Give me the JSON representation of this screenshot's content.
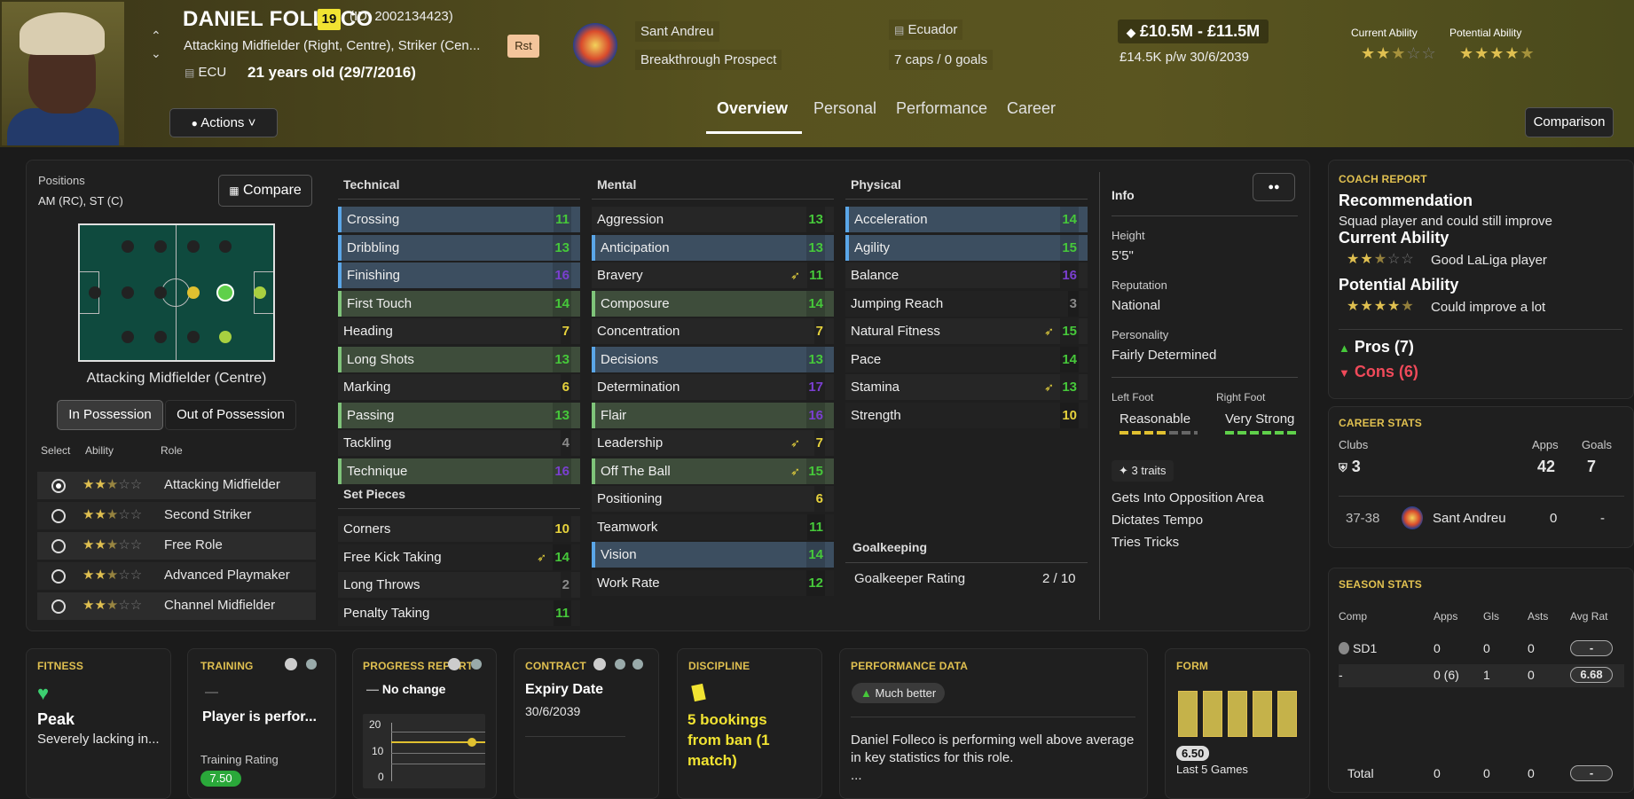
{
  "player": {
    "name": "DANIEL FOLLECO",
    "number": "19",
    "id": "(ID: 2002134423)",
    "position": "Attacking Midfielder (Right, Centre), Striker (Cen...",
    "nationality_code": "ECU",
    "age": "21 years old (29/7/2016)",
    "role_badge": "Rst"
  },
  "club": {
    "name": "Sant Andreu",
    "status": "Breakthrough Prospect"
  },
  "nation": {
    "name": "Ecuador",
    "caps": "7 caps / 0 goals"
  },
  "value": {
    "range": "£10.5M - £11.5M",
    "wage": "£14.5K p/w 30/6/2039"
  },
  "ability": {
    "current_label": "Current Ability",
    "potential_label": "Potential Ability",
    "current_stars": 2.5,
    "potential_stars": 4.5
  },
  "actions_label": "Actions",
  "tabs": [
    "Overview",
    "Personal",
    "Performance",
    "Career"
  ],
  "comparison_label": "Comparison",
  "positions": {
    "label": "Positions",
    "value": "AM (RC), ST (C)",
    "compare": "Compare",
    "role_name": "Attacking Midfielder (Centre)",
    "in_possession": "In Possession",
    "out_possession": "Out of Possession",
    "cols": [
      "Select",
      "Ability",
      "Role"
    ],
    "roles": [
      {
        "name": "Attacking Midfielder",
        "stars": 2.5,
        "selected": true
      },
      {
        "name": "Second Striker",
        "stars": 2.5,
        "selected": false
      },
      {
        "name": "Free Role",
        "stars": 2.5,
        "selected": false
      },
      {
        "name": "Advanced Playmaker",
        "stars": 2.5,
        "selected": false
      },
      {
        "name": "Channel Midfielder",
        "stars": 2.5,
        "selected": false
      }
    ]
  },
  "technical": {
    "title": "Technical",
    "items": [
      [
        "Crossing",
        "11",
        "g",
        "b"
      ],
      [
        "Dribbling",
        "13",
        "g",
        "b"
      ],
      [
        "Finishing",
        "16",
        "p",
        "b"
      ],
      [
        "First Touch",
        "14",
        "g",
        "g"
      ],
      [
        "Heading",
        "7",
        "y",
        ""
      ],
      [
        "Long Shots",
        "13",
        "g",
        "g"
      ],
      [
        "Marking",
        "6",
        "y",
        ""
      ],
      [
        "Passing",
        "13",
        "g",
        "g"
      ],
      [
        "Tackling",
        "4",
        "gr",
        ""
      ],
      [
        "Technique",
        "16",
        "p",
        "g"
      ]
    ]
  },
  "set_pieces": {
    "title": "Set Pieces",
    "items": [
      [
        "Corners",
        "10",
        "y",
        ""
      ],
      [
        "Free Kick Taking",
        "14",
        "g",
        ""
      ],
      [
        "Long Throws",
        "2",
        "gr",
        ""
      ],
      [
        "Penalty Taking",
        "11",
        "g",
        ""
      ]
    ]
  },
  "mental": {
    "title": "Mental",
    "items": [
      [
        "Aggression",
        "13",
        "g",
        ""
      ],
      [
        "Anticipation",
        "13",
        "g",
        "b"
      ],
      [
        "Bravery",
        "11",
        "g",
        ""
      ],
      [
        "Composure",
        "14",
        "g",
        "g"
      ],
      [
        "Concentration",
        "7",
        "y",
        ""
      ],
      [
        "Decisions",
        "13",
        "g",
        "b"
      ],
      [
        "Determination",
        "17",
        "p",
        ""
      ],
      [
        "Flair",
        "16",
        "p",
        "g"
      ],
      [
        "Leadership",
        "7",
        "y",
        ""
      ],
      [
        "Off The Ball",
        "15",
        "g",
        "g"
      ],
      [
        "Positioning",
        "6",
        "y",
        ""
      ],
      [
        "Teamwork",
        "11",
        "g",
        ""
      ],
      [
        "Vision",
        "14",
        "g",
        "b"
      ],
      [
        "Work Rate",
        "12",
        "g",
        ""
      ]
    ]
  },
  "physical": {
    "title": "Physical",
    "items": [
      [
        "Acceleration",
        "14",
        "g",
        "b"
      ],
      [
        "Agility",
        "15",
        "g",
        "b"
      ],
      [
        "Balance",
        "16",
        "p",
        ""
      ],
      [
        "Jumping Reach",
        "3",
        "gr",
        ""
      ],
      [
        "Natural Fitness",
        "15",
        "g",
        ""
      ],
      [
        "Pace",
        "14",
        "g",
        ""
      ],
      [
        "Stamina",
        "13",
        "g",
        ""
      ],
      [
        "Strength",
        "10",
        "y",
        ""
      ]
    ]
  },
  "goalkeeping": {
    "title": "Goalkeeping",
    "label": "Goalkeeper Rating",
    "value": "2 / 10"
  },
  "info": {
    "title": "Info",
    "height_label": "Height",
    "height": "5'5\"",
    "rep_label": "Reputation",
    "rep": "National",
    "pers_label": "Personality",
    "pers": "Fairly Determined",
    "lf_label": "Left Foot",
    "lf": "Reasonable",
    "rf_label": "Right Foot",
    "rf": "Very Strong",
    "traits_label": "3 traits",
    "traits": [
      "Gets Into Opposition Area",
      "Dictates Tempo",
      "Tries Tricks"
    ]
  },
  "coach": {
    "title": "COACH REPORT",
    "rec_h": "Recommendation",
    "rec": "Squad player and could still improve",
    "ca_h": "Current Ability",
    "ca_text": "Good LaLiga player",
    "pa_h": "Potential Ability",
    "pa_text": "Could improve a lot",
    "pros": "Pros (7)",
    "cons": "Cons (6)"
  },
  "career": {
    "title": "CAREER STATS",
    "clubs_label": "Clubs",
    "clubs": "3",
    "apps_label": "Apps",
    "apps": "42",
    "goals_label": "Goals",
    "goals": "7",
    "row": {
      "season": "37-38",
      "club": "Sant Andreu",
      "apps": "0",
      "goals": "-"
    }
  },
  "season": {
    "title": "SEASON STATS",
    "cols": [
      "Comp",
      "Apps",
      "Gls",
      "Asts",
      "Avg Rat"
    ],
    "rows": [
      [
        "SD1",
        "0",
        "0",
        "0",
        "-"
      ],
      [
        "-",
        "0 (6)",
        "1",
        "0",
        "6.68"
      ]
    ],
    "total": [
      "Total",
      "0",
      "0",
      "0",
      "-"
    ]
  },
  "fitness": {
    "title": "FITNESS",
    "status": "Peak",
    "desc": "Severely lacking in..."
  },
  "training": {
    "title": "TRAINING",
    "dash": "—",
    "text": "Player is perfor...",
    "rating_label": "Training Rating",
    "rating": "7.50"
  },
  "progress": {
    "title": "PROGRESS REPORT",
    "text": "No change",
    "ticks": [
      "20",
      "10",
      "0"
    ]
  },
  "contract": {
    "title": "CONTRACT",
    "label": "Expiry Date",
    "date": "30/6/2039"
  },
  "discipline": {
    "title": "DISCIPLINE",
    "text": "5 bookings from ban (1 match)"
  },
  "perf": {
    "title": "PERFORMANCE DATA",
    "badge": "Much better",
    "text": "Daniel Folleco is performing well above average in key statistics for this role.",
    "more": "..."
  },
  "form": {
    "title": "FORM",
    "rating": "6.50",
    "label": "Last 5 Games"
  }
}
